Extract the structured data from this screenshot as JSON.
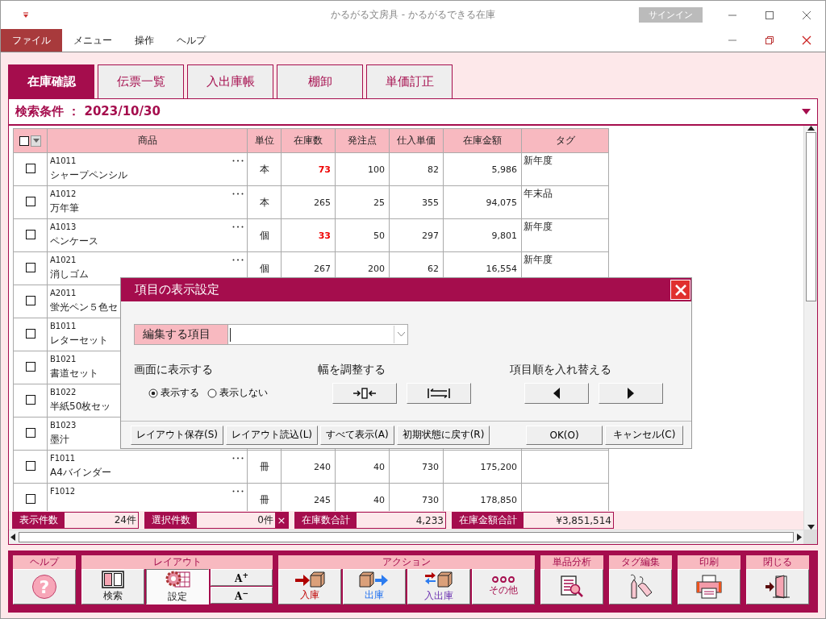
{
  "window": {
    "title": "かるがる文房具  -  かるがるできる在庫",
    "signin": "サインイン"
  },
  "menu": [
    {
      "label": "ファイル",
      "selected": true
    },
    {
      "label": "メニュー",
      "selected": false
    },
    {
      "label": "操作",
      "selected": false
    },
    {
      "label": "ヘルプ",
      "selected": false
    }
  ],
  "tabs": [
    {
      "label": "在庫確認",
      "selected": true
    },
    {
      "label": "伝票一覧",
      "selected": false
    },
    {
      "label": "入出庫帳",
      "selected": false
    },
    {
      "label": "棚卸",
      "selected": false
    },
    {
      "label": "単価訂正",
      "selected": false
    }
  ],
  "search_condition": "検索条件 ： 2023/10/30",
  "table": {
    "select_all_checked": false,
    "columns": [
      "商品",
      "単位",
      "在庫数",
      "発注点",
      "仕入単価",
      "在庫金額",
      "タグ"
    ],
    "rows": [
      {
        "checked": false,
        "code": "A1011",
        "name": "シャープペンシル",
        "unit": "本",
        "stock": "73",
        "low_stock": true,
        "reorder_point": "100",
        "unit_cost": "82",
        "stock_value": "5,986",
        "tag": "新年度"
      },
      {
        "checked": false,
        "code": "A1012",
        "name": "万年筆",
        "unit": "本",
        "stock": "265",
        "low_stock": false,
        "reorder_point": "25",
        "unit_cost": "355",
        "stock_value": "94,075",
        "tag": "年末品"
      },
      {
        "checked": false,
        "code": "A1013",
        "name": "ペンケース",
        "unit": "個",
        "stock": "33",
        "low_stock": true,
        "reorder_point": "50",
        "unit_cost": "297",
        "stock_value": "9,801",
        "tag": "新年度"
      },
      {
        "checked": false,
        "code": "A1021",
        "name": "消しゴム",
        "unit": "個",
        "stock": "267",
        "low_stock": false,
        "reorder_point": "200",
        "unit_cost": "62",
        "stock_value": "16,554",
        "tag": "新年度"
      },
      {
        "checked": false,
        "code": "A2011",
        "name": "蛍光ペン５色セ"
      },
      {
        "checked": false,
        "code": "B1011",
        "name": "レターセット"
      },
      {
        "checked": false,
        "code": "B1021",
        "name": "書道セット"
      },
      {
        "checked": false,
        "code": "B1022",
        "name": "半紙50枚セッ"
      },
      {
        "checked": false,
        "code": "B1023",
        "name": "墨汁"
      },
      {
        "checked": false,
        "code": "F1011",
        "name": "A4バインダー",
        "unit": "冊",
        "stock": "240",
        "low_stock": false,
        "reorder_point": "40",
        "unit_cost": "730",
        "stock_value": "175,200"
      },
      {
        "checked": false,
        "code": "F1012",
        "unit": "冊",
        "stock": "245",
        "low_stock": false,
        "reorder_point": "40",
        "unit_cost": "730",
        "stock_value": "178,850"
      }
    ]
  },
  "status": [
    {
      "label": "表示件数",
      "value": "24件"
    },
    {
      "label": "選択件数",
      "value": "0件",
      "clear": "×"
    },
    {
      "label": "在庫数合計",
      "value": "4,233"
    },
    {
      "label": "在庫金額合計",
      "value": "¥3,851,514"
    }
  ],
  "dialog": {
    "title": "項目の表示設定",
    "field_label": "編集する項目",
    "show_label": "画面に表示する",
    "show_options": [
      {
        "label": "表示する",
        "selected": true
      },
      {
        "label": "表示しない",
        "selected": false
      }
    ],
    "width_label": "幅を調整する",
    "order_label": "項目順を入れ替える",
    "footer_buttons": [
      "レイアウト保存(S)",
      "レイアウト読込(L)",
      "すべて表示(A)",
      "初期状態に戻す(R)"
    ],
    "ok": "OK(O)",
    "cancel": "キャンセル(C)"
  },
  "toolbar": [
    {
      "title": "ヘルプ",
      "buttons": [
        {
          "kind": "help",
          "label": "?",
          "selected": false
        }
      ]
    },
    {
      "title": "レイアウト",
      "buttons": [
        {
          "kind": "panels",
          "label": "検索",
          "selected": false
        },
        {
          "kind": "settings",
          "label": "設定",
          "selected": true
        },
        {
          "kind": "fontsize",
          "labels": [
            "A$^{+}$",
            "A$^{−}$"
          ],
          "selected": false
        }
      ]
    },
    {
      "title": "アクション",
      "buttons": [
        {
          "kind": "receive",
          "label": "入庫",
          "selected": false
        },
        {
          "kind": "ship",
          "label": "出庫",
          "selected": false
        },
        {
          "kind": "transfer",
          "label": "入出庫",
          "selected": false
        },
        {
          "kind": "more",
          "label": "その他",
          "selected": false
        }
      ]
    },
    {
      "title": "単品分析",
      "buttons": [
        {
          "kind": "analysis",
          "selected": false
        }
      ]
    },
    {
      "title": "タグ編集",
      "buttons": [
        {
          "kind": "tags",
          "selected": false
        }
      ]
    },
    {
      "title": "印刷",
      "buttons": [
        {
          "kind": "print",
          "selected": false
        }
      ]
    },
    {
      "title": "閉じる",
      "buttons": [
        {
          "kind": "exit",
          "selected": false
        }
      ]
    }
  ]
}
